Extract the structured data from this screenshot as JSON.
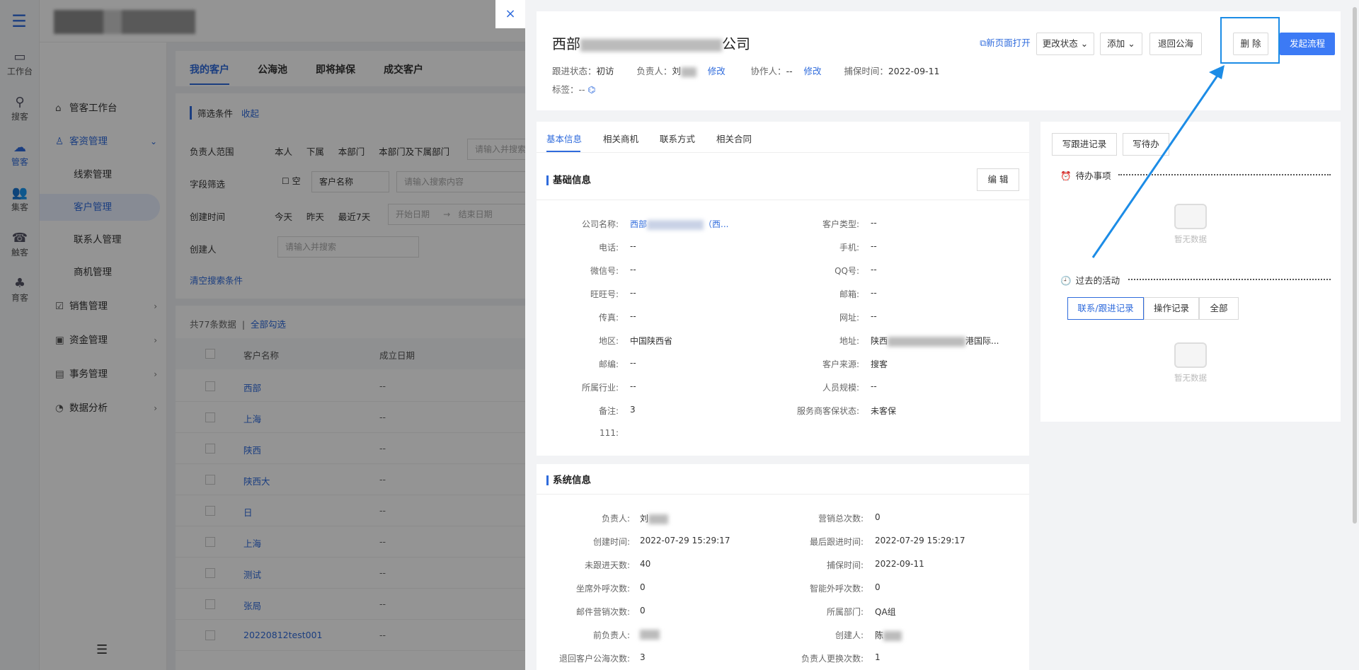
{
  "sidebar_icons": [
    {
      "label": "工作台",
      "icon": "desktop-icon"
    },
    {
      "label": "搜客",
      "icon": "person-search-icon"
    },
    {
      "label": "管客",
      "icon": "cloud-icon"
    },
    {
      "label": "集客",
      "icon": "group-icon"
    },
    {
      "label": "触客",
      "icon": "contact-icon"
    },
    {
      "label": "育客",
      "icon": "nurture-icon"
    }
  ],
  "nav": {
    "items": [
      {
        "label": "管客工作台"
      },
      {
        "label": "客资管理"
      },
      {
        "label": "线索管理"
      },
      {
        "label": "客户管理"
      },
      {
        "label": "联系人管理"
      },
      {
        "label": "商机管理"
      },
      {
        "label": "销售管理"
      },
      {
        "label": "资金管理"
      },
      {
        "label": "事务管理"
      },
      {
        "label": "数据分析"
      }
    ]
  },
  "main_tabs": [
    "我的客户",
    "公海池",
    "即将掉保",
    "成交客户"
  ],
  "filters": {
    "title": "筛选条件",
    "collapse": "收起",
    "owner_label": "负责人范围",
    "owner_options": [
      "本人",
      "下属",
      "本部门",
      "本部门及下属部门"
    ],
    "owner_placeholder": "请输入并搜索",
    "field_label": "字段筛选",
    "empty_label": "空",
    "field_select": "客户名称",
    "field_placeholder": "请输入搜索内容",
    "time_label": "创建时间",
    "time_options": [
      "今天",
      "昨天",
      "最近7天"
    ],
    "start_placeholder": "开始日期",
    "end_placeholder": "结束日期",
    "creator_label": "创建人",
    "creator_placeholder": "请输入并搜索",
    "clear": "清空搜索条件"
  },
  "list": {
    "total": "共77条数据",
    "select_all": "全部勾选",
    "col_name": "客户名称",
    "col_date": "成立日期",
    "rows": [
      {
        "name": "西部",
        "date": "--"
      },
      {
        "name": "上海",
        "date": "--"
      },
      {
        "name": "陕西",
        "date": "--"
      },
      {
        "name": "陕西大",
        "date": "--"
      },
      {
        "name": "日",
        "date": "--"
      },
      {
        "name": "上海",
        "date": "--"
      },
      {
        "name": "测试",
        "date": "--"
      },
      {
        "name": "张局",
        "date": "--"
      },
      {
        "name": "20220812test001",
        "date": "--"
      }
    ]
  },
  "drawer": {
    "close": "×",
    "title_left": "西部",
    "title_right": "公司",
    "status_label": "跟进状态：",
    "status_value": "初访",
    "owner_label": "负责人：",
    "owner_value": "刘",
    "modify": "修改",
    "collab_label": "协作人：",
    "collab_value": "--",
    "grab_label": "捕保时间：",
    "grab_value": "2022-09-11",
    "tags_label": "标签：",
    "tags_value": "--",
    "actions": {
      "open_new": "新页面打开",
      "change_status": "更改状态",
      "add": "添加",
      "return_pool": "退回公海",
      "delete": "删 除",
      "start_flow": "发起流程"
    },
    "info_tabs": [
      "基本信息",
      "相关商机",
      "联系方式",
      "相关合同"
    ],
    "basic_title": "基础信息",
    "edit": "编 辑",
    "basic": {
      "left": [
        {
          "k": "公司名称:",
          "v": "西部"
        },
        {
          "k": "电话:",
          "v": "--"
        },
        {
          "k": "微信号:",
          "v": "--"
        },
        {
          "k": "旺旺号:",
          "v": "--"
        },
        {
          "k": "传真:",
          "v": "--"
        },
        {
          "k": "地区:",
          "v": "中国陕西省"
        },
        {
          "k": "邮编:",
          "v": "--"
        },
        {
          "k": "所属行业:",
          "v": "--"
        },
        {
          "k": "备注:",
          "v": "3"
        },
        {
          "k": "111:",
          "v": ""
        }
      ],
      "company_suffix": "（西...",
      "right": [
        {
          "k": "客户类型:",
          "v": "--"
        },
        {
          "k": "手机:",
          "v": "--"
        },
        {
          "k": "QQ号:",
          "v": "--"
        },
        {
          "k": "邮箱:",
          "v": "--"
        },
        {
          "k": "网址:",
          "v": "--"
        },
        {
          "k": "地址:",
          "v": "陕西"
        },
        {
          "k": "客户来源:",
          "v": "搜客"
        },
        {
          "k": "人员规模:",
          "v": "--"
        },
        {
          "k": "服务商客保状态:",
          "v": "未客保"
        }
      ],
      "address_suffix": "港国际..."
    },
    "sys_title": "系统信息",
    "sys": {
      "left": [
        {
          "k": "负责人:",
          "v": "刘"
        },
        {
          "k": "创建时间:",
          "v": "2022-07-29 15:29:17"
        },
        {
          "k": "未跟进天数:",
          "v": "40"
        },
        {
          "k": "坐席外呼次数:",
          "v": "0"
        },
        {
          "k": "邮件营销次数:",
          "v": "0"
        },
        {
          "k": "前负责人:",
          "v": ""
        },
        {
          "k": "退回客户公海次数:",
          "v": "3"
        }
      ],
      "right": [
        {
          "k": "营销总次数:",
          "v": "0"
        },
        {
          "k": "最后跟进时间:",
          "v": "2022-07-29 15:29:17"
        },
        {
          "k": "捕保时间:",
          "v": "2022-09-11"
        },
        {
          "k": "智能外呼次数:",
          "v": "0"
        },
        {
          "k": "所属部门:",
          "v": "QA组"
        },
        {
          "k": "创建人:",
          "v": "陈"
        },
        {
          "k": "负责人更换次数:",
          "v": "1"
        }
      ]
    },
    "right": {
      "write_followup": "写跟进记录",
      "write_todo": "写待办",
      "todo_title": "待办事项",
      "no_data": "暂无数据",
      "past_title": "过去的活动",
      "seg": [
        "联系/跟进记录",
        "操作记录",
        "全部"
      ],
      "no_data2": "暂无数据"
    }
  },
  "colors": {
    "accent": "#2f6bdc",
    "primary_button": "#3c7af5",
    "highlight": "#1c8ce6"
  }
}
